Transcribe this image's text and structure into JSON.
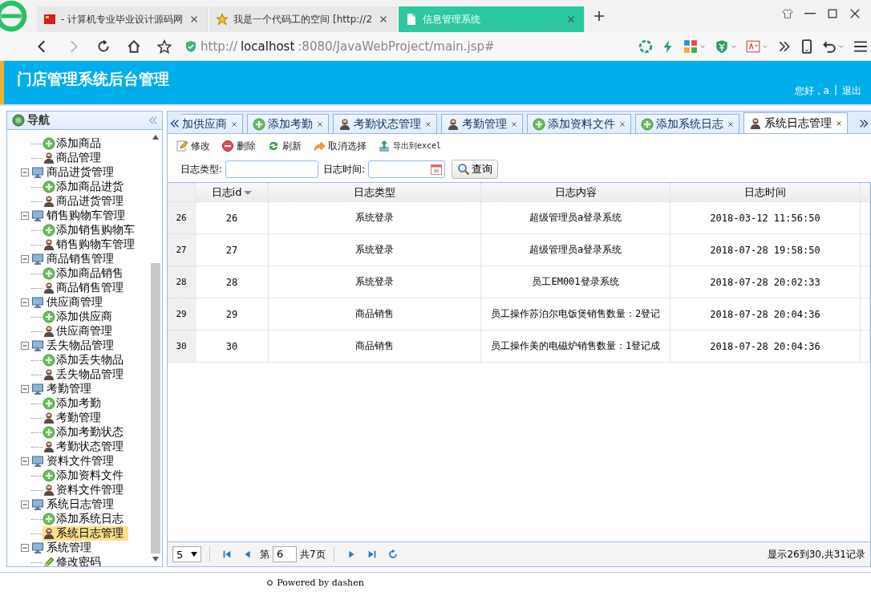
{
  "browser": {
    "tabs": [
      {
        "title": "- 计算机专业毕业设计源码网",
        "kind": "flag",
        "selected": false
      },
      {
        "title": "我是一个代码工的空间 [http://2",
        "kind": "star",
        "selected": false
      },
      {
        "title": "信息管理系统",
        "kind": "page",
        "selected": true
      }
    ],
    "address": {
      "scheme": "http://",
      "host": "localhost",
      "path": ":8080/JavaWebProject/main.jsp#"
    }
  },
  "header": {
    "title": "门店管理系统后台管理",
    "greeting": "您好，a",
    "separator": "|",
    "logout": "退出"
  },
  "sidebar": {
    "title": "导航",
    "tree": [
      {
        "label": "添加商品",
        "kind": "add",
        "selected": false
      },
      {
        "label": "商品管理",
        "kind": "manage",
        "selected": false
      },
      {
        "label": "商品进货管理",
        "kind": "group",
        "expanded": true,
        "children": [
          {
            "label": "添加商品进货",
            "kind": "add",
            "selected": false
          },
          {
            "label": "商品进货管理",
            "kind": "manage",
            "selected": false
          }
        ]
      },
      {
        "label": "销售购物车管理",
        "kind": "group",
        "expanded": true,
        "children": [
          {
            "label": "添加销售购物车",
            "kind": "add",
            "selected": false
          },
          {
            "label": "销售购物车管理",
            "kind": "manage",
            "selected": false
          }
        ]
      },
      {
        "label": "商品销售管理",
        "kind": "group",
        "expanded": true,
        "children": [
          {
            "label": "添加商品销售",
            "kind": "add",
            "selected": false
          },
          {
            "label": "商品销售管理",
            "kind": "manage",
            "selected": false
          }
        ]
      },
      {
        "label": "供应商管理",
        "kind": "group",
        "expanded": true,
        "children": [
          {
            "label": "添加供应商",
            "kind": "add",
            "selected": false
          },
          {
            "label": "供应商管理",
            "kind": "manage",
            "selected": false
          }
        ]
      },
      {
        "label": "丢失物品管理",
        "kind": "group",
        "expanded": true,
        "children": [
          {
            "label": "添加丢失物品",
            "kind": "add",
            "selected": false
          },
          {
            "label": "丢失物品管理",
            "kind": "manage",
            "selected": false
          }
        ]
      },
      {
        "label": "考勤管理",
        "kind": "group",
        "expanded": true,
        "children": [
          {
            "label": "添加考勤",
            "kind": "add",
            "selected": false
          },
          {
            "label": "考勤管理",
            "kind": "manage",
            "selected": false
          },
          {
            "label": "添加考勤状态",
            "kind": "add",
            "selected": false
          },
          {
            "label": "考勤状态管理",
            "kind": "manage",
            "selected": false
          }
        ]
      },
      {
        "label": "资料文件管理",
        "kind": "group",
        "expanded": true,
        "children": [
          {
            "label": "添加资料文件",
            "kind": "add",
            "selected": false
          },
          {
            "label": "资料文件管理",
            "kind": "manage",
            "selected": false
          }
        ]
      },
      {
        "label": "系统日志管理",
        "kind": "group",
        "expanded": true,
        "children": [
          {
            "label": "添加系统日志",
            "kind": "add",
            "selected": false
          },
          {
            "label": "系统日志管理",
            "kind": "manage",
            "selected": true
          }
        ]
      },
      {
        "label": "系统管理",
        "kind": "group",
        "expanded": true,
        "children": [
          {
            "label": "修改密码",
            "kind": "edit",
            "selected": false
          }
        ]
      }
    ]
  },
  "tabs": [
    {
      "label": "加供应商",
      "kind": "plain",
      "selected": false
    },
    {
      "label": "添加考勤",
      "kind": "add",
      "selected": false
    },
    {
      "label": "考勤状态管理",
      "kind": "manage",
      "selected": false
    },
    {
      "label": "考勤管理",
      "kind": "manage",
      "selected": false
    },
    {
      "label": "添加资料文件",
      "kind": "add",
      "selected": false
    },
    {
      "label": "添加系统日志",
      "kind": "add",
      "selected": false
    },
    {
      "label": "系统日志管理",
      "kind": "manage",
      "selected": true
    }
  ],
  "toolbar": [
    {
      "label": "修改",
      "kind": "edit"
    },
    {
      "label": "删除",
      "kind": "delete"
    },
    {
      "label": "刷新",
      "kind": "refresh"
    },
    {
      "label": "取消选择",
      "kind": "undo"
    },
    {
      "label": "导出到excel",
      "kind": "export"
    }
  ],
  "search": {
    "fields": [
      {
        "label": "日志类型:",
        "kind": "text"
      },
      {
        "label": "日志时间:",
        "kind": "date"
      }
    ],
    "button": "查询"
  },
  "table": {
    "columns": [
      {
        "label": "日志id",
        "sorted": true
      },
      {
        "label": "日志类型"
      },
      {
        "label": "日志内容"
      },
      {
        "label": "日志时间"
      }
    ],
    "rows": [
      {
        "row_number": "26",
        "cells": [
          "26",
          "系统登录",
          "超级管理员a登录系统",
          "2018-03-12 11:56:50"
        ]
      },
      {
        "row_number": "27",
        "cells": [
          "27",
          "系统登录",
          "超级管理员a登录系统",
          "2018-07-28 19:58:50"
        ]
      },
      {
        "row_number": "28",
        "cells": [
          "28",
          "系统登录",
          "员工EM001登录系统",
          "2018-07-28 20:02:33"
        ]
      },
      {
        "row_number": "29",
        "cells": [
          "29",
          "商品销售",
          "员工操作苏泊尔电饭煲销售数量：2登记",
          "2018-07-28 20:04:36"
        ]
      },
      {
        "row_number": "30",
        "cells": [
          "30",
          "商品销售",
          "员工操作美的电磁炉销售数量：1登记成",
          "2018-07-28 20:04:36"
        ]
      }
    ]
  },
  "pager": {
    "page_size": "5",
    "page_label": "第",
    "page": "6",
    "total_pages": "共7页",
    "summary": "显示26到30,共31记录"
  },
  "footer": "Powered by dashen"
}
